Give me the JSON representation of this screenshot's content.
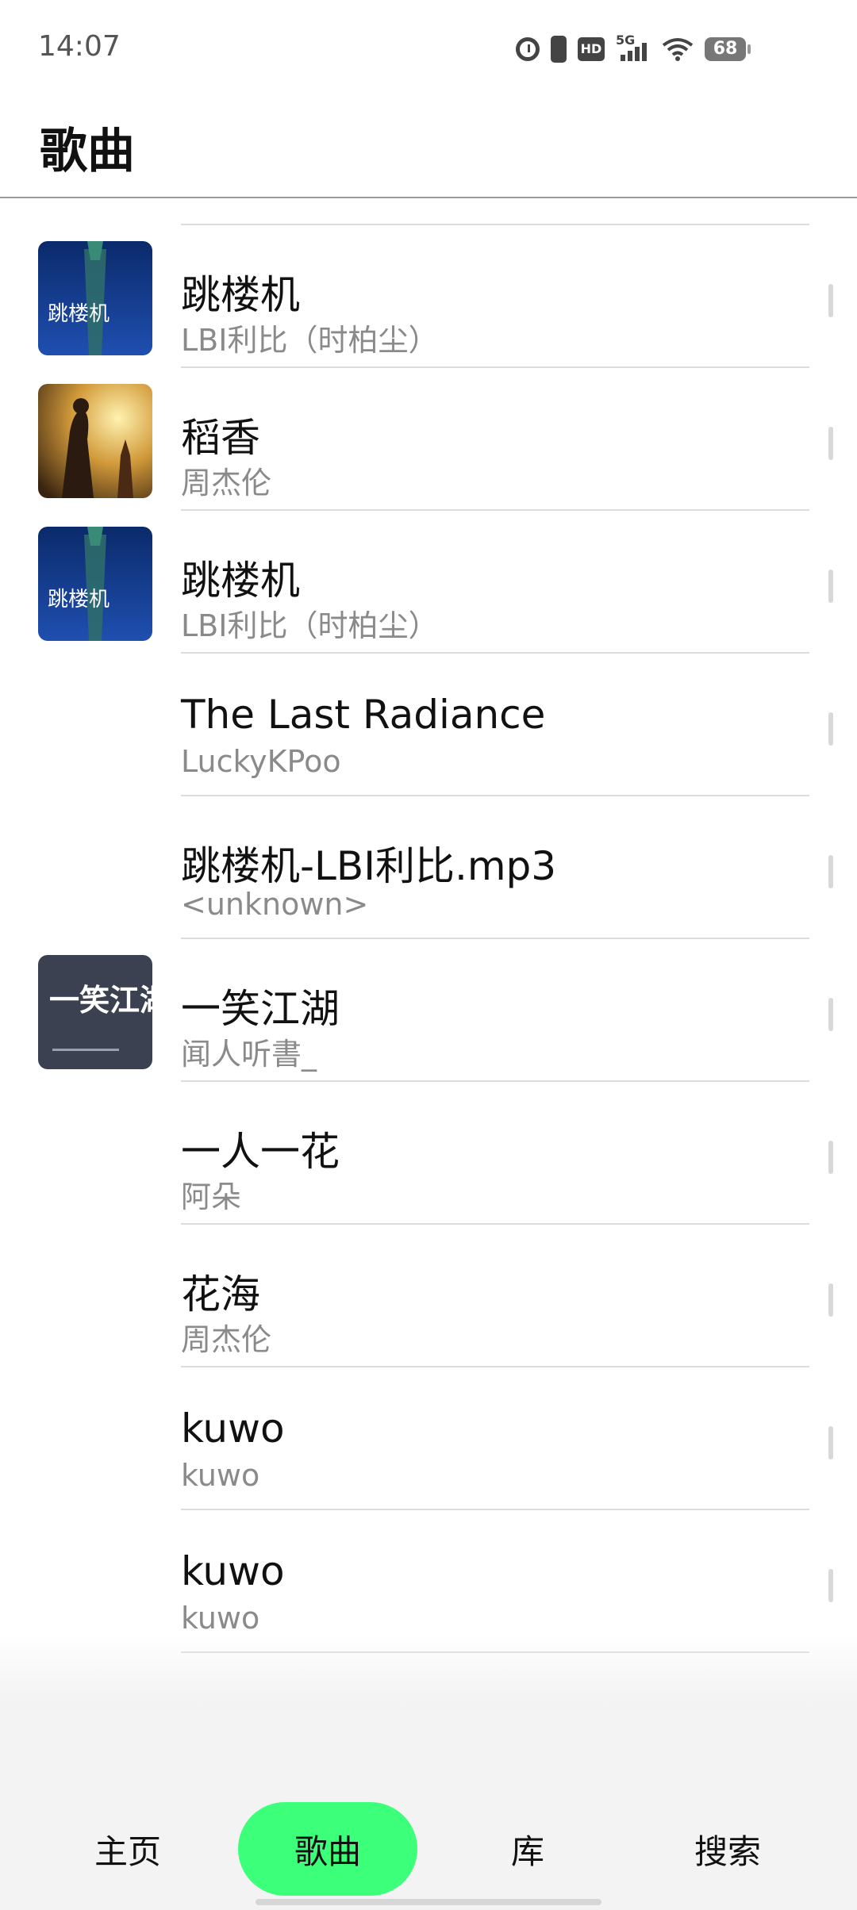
{
  "status_bar": {
    "time": "14:07",
    "network": "5G",
    "hd": "HD",
    "battery": "68"
  },
  "header": {
    "title": "歌曲"
  },
  "songs": [
    {
      "title": "跳楼机",
      "artist": "LBI利比（时柏尘）",
      "art": "tower"
    },
    {
      "title": "稻香",
      "artist": "周杰伦",
      "art": "warrior"
    },
    {
      "title": "跳楼机",
      "artist": "LBI利比（时柏尘）",
      "art": "tower"
    },
    {
      "title": "The Last Radiance",
      "artist": "LuckyKPoo",
      "art": ""
    },
    {
      "title": "跳楼机-LBI利比.mp3",
      "artist": "<unknown>",
      "art": ""
    },
    {
      "title": "一笑江湖",
      "artist": "闻人听書_",
      "art": "calligraphy"
    },
    {
      "title": "一人一花",
      "artist": "阿朵",
      "art": ""
    },
    {
      "title": "花海",
      "artist": "周杰伦",
      "art": ""
    },
    {
      "title": "kuwo",
      "artist": "kuwo",
      "art": ""
    },
    {
      "title": "kuwo",
      "artist": "kuwo",
      "art": ""
    }
  ],
  "album_art_text": {
    "tower": "跳楼机",
    "calligraphy": "一笑江湖"
  },
  "nav": {
    "home": "主页",
    "songs": "歌曲",
    "library": "库",
    "search": "搜索",
    "active": "songs"
  },
  "colors": {
    "accent": "#3cff7a",
    "divider": "#dcdcdc",
    "secondary_text": "#8a8a8a"
  }
}
